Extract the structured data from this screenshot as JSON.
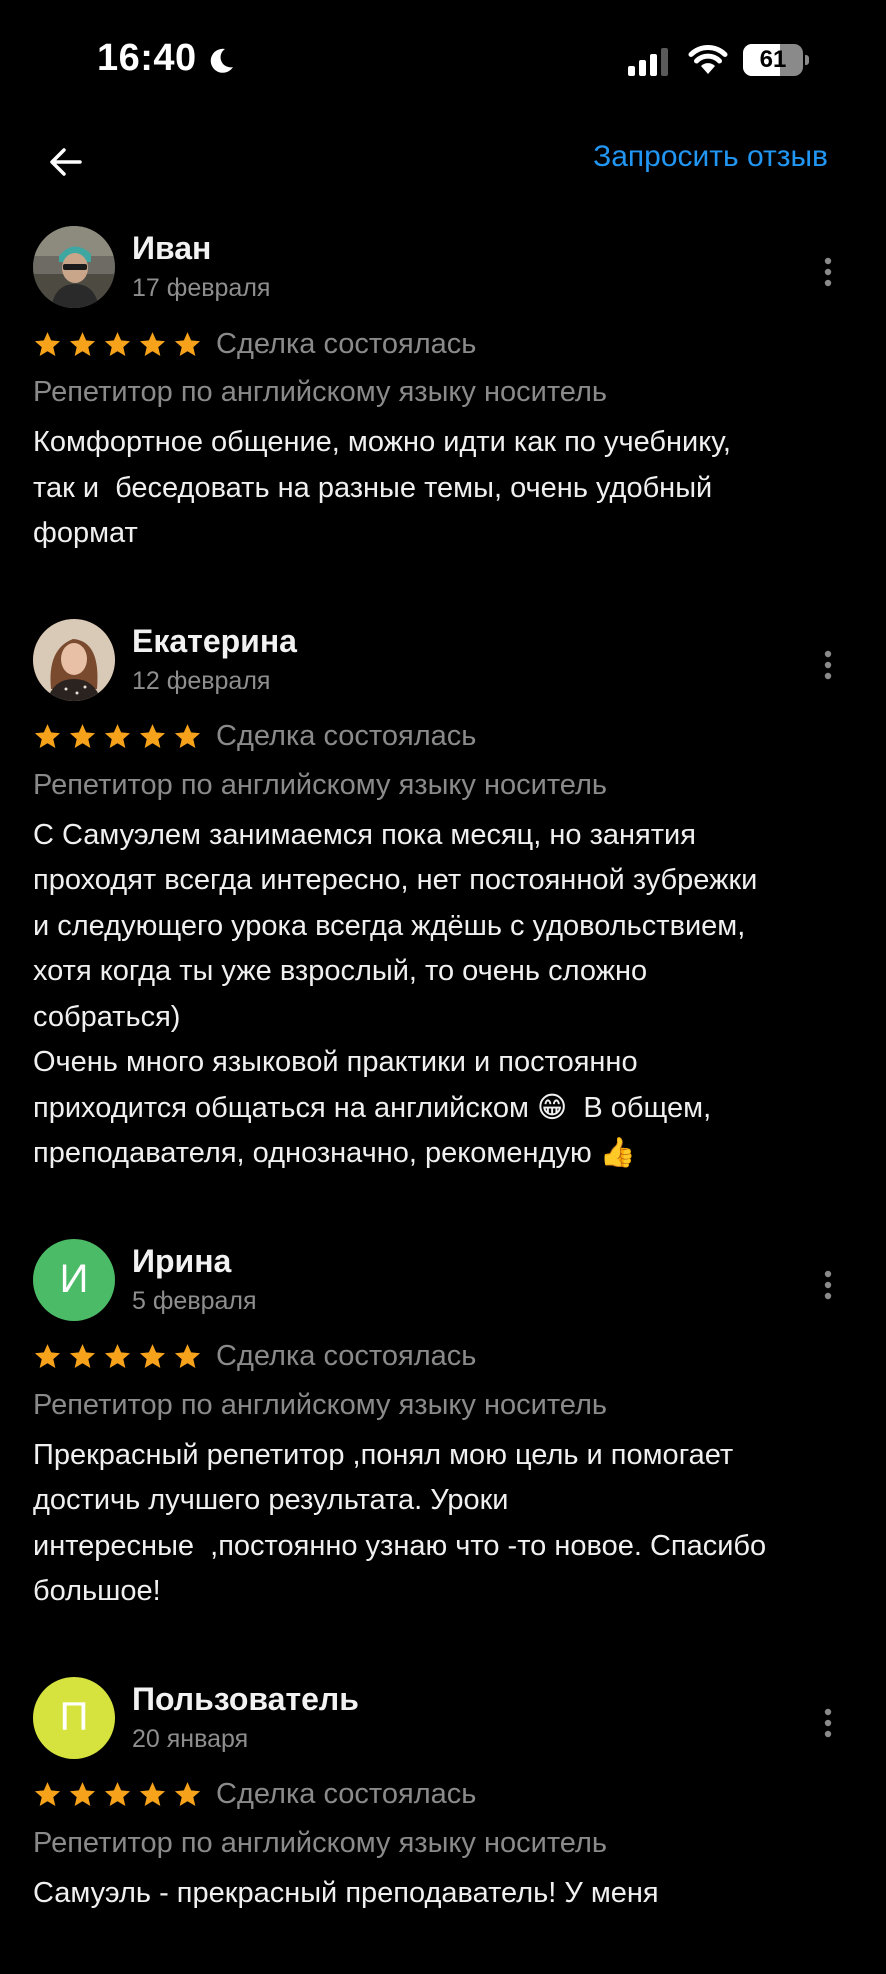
{
  "status_bar": {
    "time": "16:40",
    "battery": "61",
    "battery_level_percent": 61,
    "icons": [
      "moon-icon",
      "signal-icon",
      "wifi-icon",
      "battery-icon"
    ]
  },
  "nav": {
    "back_icon": "arrow-left-icon",
    "request_review_label": "Запросить отзыв",
    "link_color": "#2196f3"
  },
  "colors": {
    "background": "#000000",
    "star": "#f7a21b",
    "muted_text": "#8a8a8a"
  },
  "reviews": [
    {
      "author": "Иван",
      "date": "17 февраля",
      "avatar": {
        "type": "photo",
        "initial": "",
        "color": "#3d3a34"
      },
      "rating": 5,
      "status": "Сделка состоялась",
      "service": "Репетитор по английскому языку носитель",
      "text": "Комфортное общение, можно идти как по учебнику,\nтак и  беседовать на разные темы, очень удобный\nформат"
    },
    {
      "author": "Екатерина",
      "date": "12 февраля",
      "avatar": {
        "type": "photo",
        "initial": "",
        "color": "#6a4c3b"
      },
      "rating": 5,
      "status": "Сделка состоялась",
      "service": "Репетитор по английскому языку носитель",
      "text": "С Самуэлем занимаемся пока месяц, но занятия\nпроходят всегда интересно, нет постоянной зубрежки\nи следующего урока всегда ждёшь с удовольствием,\nхотя когда ты уже взрослый, то очень сложно\nсобраться)\nОчень много языковой практики и постоянно\nприходится общаться на английском 😁  В общем,\nпреподавателя, однозначно, рекомендую 👍"
    },
    {
      "author": "Ирина",
      "date": "5 февраля",
      "avatar": {
        "type": "initial",
        "initial": "И",
        "color": "#4cbb67"
      },
      "rating": 5,
      "status": "Сделка состоялась",
      "service": "Репетитор по английскому языку носитель",
      "text": "Прекрасный репетитор ,понял мою цель и помогает\nдостичь лучшего результата. Уроки\nинтересные  ,постоянно узнаю что -то новое. Спасибо\nбольшое!"
    },
    {
      "author": "Пользователь",
      "date": "20 января",
      "avatar": {
        "type": "initial",
        "initial": "П",
        "color": "#d6e33f"
      },
      "rating": 5,
      "status": "Сделка состоялась",
      "service": "Репетитор по английскому языку носитель",
      "text": "Самуэль - прекрасный преподаватель! У меня"
    }
  ]
}
